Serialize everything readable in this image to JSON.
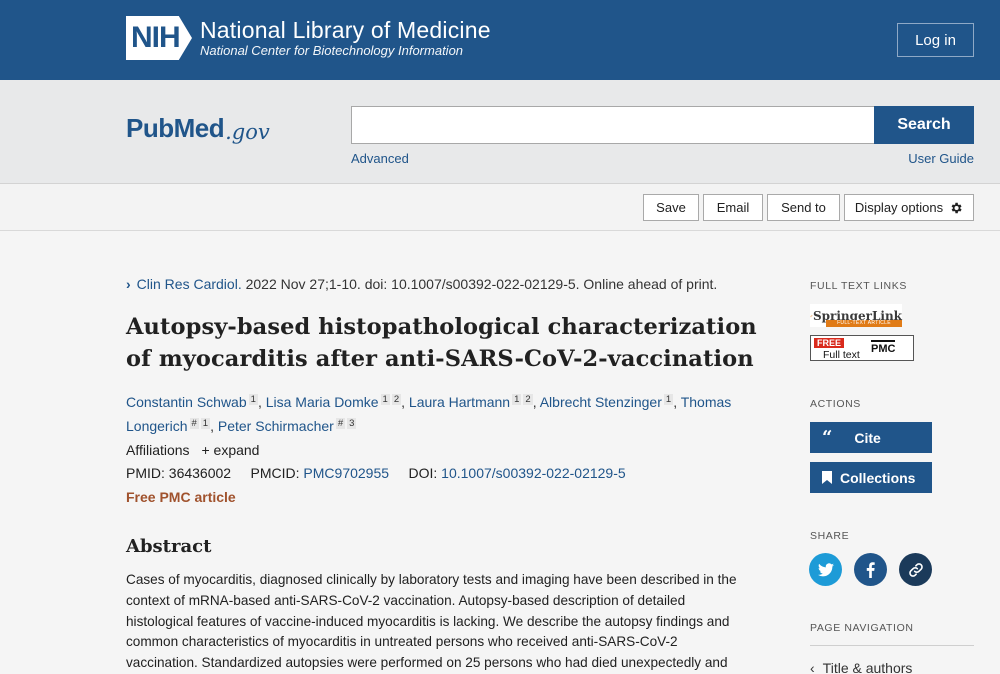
{
  "nih": {
    "mark": "NIH",
    "title": "National Library of Medicine",
    "subtitle": "National Center for Biotechnology Information",
    "login_label": "Log in"
  },
  "pubmed": {
    "logo_pub": "Pub",
    "logo_med": "Med",
    "logo_gov": ".gov",
    "search_value": "",
    "search_label": "Search",
    "advanced_label": "Advanced",
    "user_guide_label": "User Guide"
  },
  "toolbar": {
    "save": "Save",
    "email": "Email",
    "send_to": "Send to",
    "display_options": "Display options"
  },
  "article": {
    "journal": "Clin Res Cardiol.",
    "citation_rest": " 2022 Nov 27;1-10. doi: 10.1007/s00392-022-02129-5. Online ahead of print.",
    "title": "Autopsy-based histopathological characterization of myocarditis after anti-SARS-CoV-2-vaccination",
    "authors": [
      {
        "name": "Constantin Schwab",
        "affils": [
          "1"
        ]
      },
      {
        "name": "Lisa Maria Domke",
        "affils": [
          "1",
          "2"
        ]
      },
      {
        "name": "Laura Hartmann",
        "affils": [
          "1",
          "2"
        ]
      },
      {
        "name": "Albrecht Stenzinger",
        "affils": [
          "1"
        ]
      },
      {
        "name": "Thomas Longerich",
        "affils": [
          "#",
          "1"
        ]
      },
      {
        "name": "Peter Schirmacher",
        "affils": [
          "#",
          "3"
        ]
      }
    ],
    "affiliations_label": "Affiliations",
    "expand_label": "expand",
    "pmid_label": "PMID:",
    "pmid": "36436002",
    "pmcid_label": "PMCID:",
    "pmcid": "PMC9702955",
    "doi_label": "DOI:",
    "doi": "10.1007/s00392-022-02129-5",
    "free_pmc": "Free PMC article",
    "abstract_heading": "Abstract",
    "abstract_text": "Cases of myocarditis, diagnosed clinically by laboratory tests and imaging have been described in the context of mRNA-based anti-SARS-CoV-2 vaccination. Autopsy-based description of detailed histological features of vaccine-induced myocarditis is lacking. We describe the autopsy findings and common characteristics of myocarditis in untreated persons who received anti-SARS-CoV-2 vaccination. Standardized autopsies were performed on 25 persons who had died unexpectedly and"
  },
  "sidebar": {
    "full_text_heading": "FULL TEXT LINKS",
    "springer_name": "SpringerLink",
    "springer_sub": "FULL-TEXT ARTICLE",
    "pmc_free": "FREE",
    "pmc_full": "Full text",
    "pmc_mark": "PMC",
    "actions_heading": "ACTIONS",
    "cite_label": "Cite",
    "collections_label": "Collections",
    "share_heading": "SHARE",
    "page_nav_heading": "PAGE NAVIGATION",
    "nav_item": "Title & authors"
  },
  "colors": {
    "brand_blue": "#20558a",
    "free_pmc": "#a0522d",
    "twitter": "#1d9bd7",
    "facebook": "#20558a",
    "permalink": "#1b3a5a"
  }
}
